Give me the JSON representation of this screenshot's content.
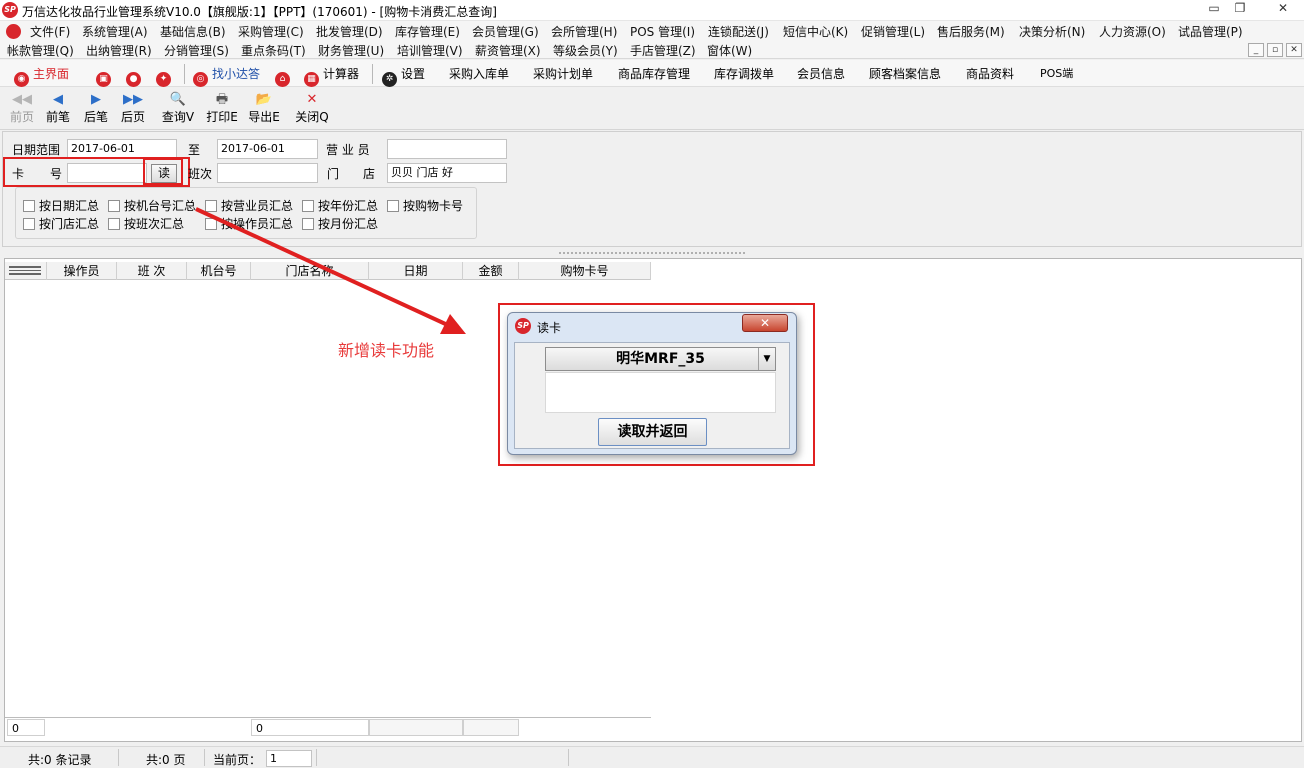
{
  "window": {
    "title": "万信达化妆品行业管理系统V10.0【旗舰版:1】【PPT】(170601) - [购物卡消费汇总查询]",
    "logo_text": "SP",
    "min_glyph": "▭",
    "restore_glyph": "❐",
    "close_glyph": "✕"
  },
  "menu_row1": [
    "文件(F)",
    "系统管理(A)",
    "基础信息(B)",
    "采购管理(C)",
    "批发管理(D)",
    "库存管理(E)",
    "会员管理(G)",
    "会所管理(H)",
    "POS 管理(I)",
    "连锁配送(J)",
    "短信中心(K)",
    "促销管理(L)",
    "售后服务(M)",
    "决策分析(N)",
    "人力资源(O)",
    "试品管理(P)"
  ],
  "menu_row2": [
    "帐款管理(Q)",
    "出纳管理(R)",
    "分销管理(S)",
    "重点条码(T)",
    "财务管理(U)",
    "培训管理(V)",
    "薪资管理(X)",
    "等级会员(Y)",
    "手店管理(Z)",
    "窗体(W)"
  ],
  "mdi_buttons": [
    "_",
    "▫",
    "✕"
  ],
  "quickbar": {
    "home": "主界面",
    "find_helper": "找小达答",
    "calculator": "计算器",
    "settings": "设置",
    "links": [
      "采购入库单",
      "采购计划单",
      "商品库存管理",
      "库存调拨单",
      "会员信息",
      "顾客档案信息",
      "商品资料",
      "POS端"
    ]
  },
  "actionbar": [
    {
      "label": "前页",
      "glyph": "◀◀",
      "enabled": false
    },
    {
      "label": "前笔",
      "glyph": "◀",
      "enabled": true
    },
    {
      "label": "后笔",
      "glyph": "▶",
      "enabled": true
    },
    {
      "label": "后页",
      "glyph": "▶▶",
      "enabled": true
    },
    {
      "label": "查询V",
      "glyph": "🔍",
      "enabled": true
    },
    {
      "label": "打印E",
      "glyph": "🖶",
      "enabled": true
    },
    {
      "label": "导出E",
      "glyph": "📂",
      "enabled": true
    },
    {
      "label": "关闭Q",
      "glyph": "✕",
      "enabled": true
    }
  ],
  "criteria": {
    "date_label": "日期范围",
    "date_from": "2017-06-01",
    "to_label": "至",
    "date_to": "2017-06-01",
    "salesperson_label": "营 业 员",
    "salesperson_value": "",
    "card_label_1": "卡",
    "card_label_2": "号",
    "card_value": "",
    "read_button": "读",
    "shift_label": "班次",
    "shift_value": "",
    "store_label_1": "门",
    "store_label_2": "店",
    "store_value": "贝贝 门店 好"
  },
  "checkboxes": [
    "按日期汇总",
    "按机台号汇总",
    "按营业员汇总",
    "按年份汇总",
    "按购物卡号",
    "按门店汇总",
    "按班次汇总",
    "按操作员汇总",
    "按月份汇总"
  ],
  "grid": {
    "columns": [
      "操作员",
      "班 次",
      "机台号",
      "门店名称",
      "日期",
      "金额",
      "购物卡号"
    ],
    "footer_count": "0",
    "footer_sum": "0"
  },
  "status": {
    "records": "共:0 条记录",
    "pages": "共:0 页",
    "current_page_label": "当前页：",
    "current_page_value": "1"
  },
  "annotation": "新增读卡功能",
  "dialog": {
    "title": "读卡",
    "close": "✕",
    "selected_reader": "明华MRF_35",
    "dropdown_arrow": "▼",
    "confirm_button": "读取并返回"
  },
  "colors": {
    "accent_red": "#e02020",
    "annotation_red": "#e83b3b",
    "brand_red": "#d8262c",
    "icon_blue": "#2d6fc8"
  }
}
